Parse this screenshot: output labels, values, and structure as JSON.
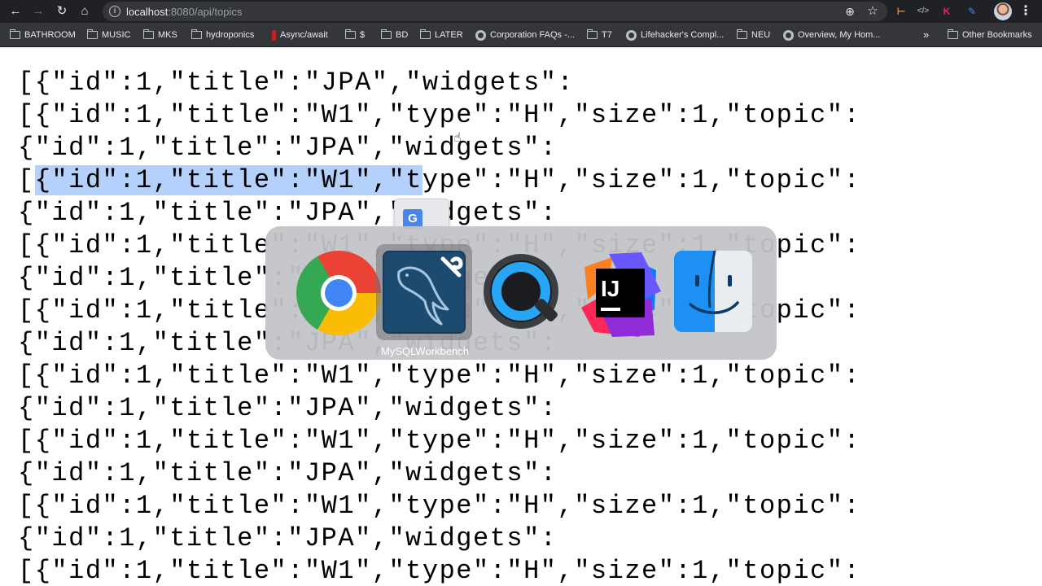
{
  "browser": {
    "url_host": "localhost",
    "url_rest": ":8080/api/topics"
  },
  "bookmarks": [
    {
      "label": "BATHROOM",
      "icon": "folder-icon"
    },
    {
      "label": "MUSIC",
      "icon": "folder-icon"
    },
    {
      "label": "MKS",
      "icon": "folder-icon"
    },
    {
      "label": "hydroponics",
      "icon": "folder-icon"
    },
    {
      "label": "Async/await",
      "icon": "bookmark-icon"
    },
    {
      "label": "$",
      "icon": "folder-icon"
    },
    {
      "label": "BD",
      "icon": "folder-icon"
    },
    {
      "label": "LATER",
      "icon": "folder-icon"
    },
    {
      "label": "Corporation FAQs -...",
      "icon": "globe-icon"
    },
    {
      "label": "T7",
      "icon": "folder-icon"
    },
    {
      "label": "Lifehacker's Compl...",
      "icon": "globe-icon"
    },
    {
      "label": "NEU",
      "icon": "folder-icon"
    },
    {
      "label": "Overview, My Hom...",
      "icon": "globe-icon"
    },
    {
      "label": "Other Bookmarks",
      "icon": "folder-icon"
    }
  ],
  "bookmarks_overflow": "»",
  "json_lines": [
    "[{\"id\":1,\"title\":\"JPA\",\"widgets\":",
    "[{\"id\":1,\"title\":\"W1\",\"type\":\"H\",\"size\":1,\"topic\":",
    "{\"id\":1,\"title\":\"JPA\",\"widgets\":",
    "[{\"id\":1,\"title\":\"W1\",\"type\":\"H\",\"size\":1,\"topic\":",
    "{\"id\":1,\"title\":\"JPA\",\"widgets\":",
    "[{\"id\":1,\"title\":\"W1\",\"type\":\"H\",\"size\":1,\"topic\":",
    "{\"id\":1,\"title\":\"JPA\",\"widgets\":",
    "[{\"id\":1,\"title\":\"W1\",\"type\":\"H\",\"size\":1,\"topic\":",
    "{\"id\":1,\"title\":\"JPA\",\"widgets\":",
    "[{\"id\":1,\"title\":\"W1\",\"type\":\"H\",\"size\":1,\"topic\":",
    "{\"id\":1,\"title\":\"JPA\",\"widgets\":",
    "[{\"id\":1,\"title\":\"W1\",\"type\":\"H\",\"size\":1,\"topic\":",
    "{\"id\":1,\"title\":\"JPA\",\"widgets\":",
    "[{\"id\":1,\"title\":\"W1\",\"type\":\"H\",\"size\":1,\"topic\":",
    "{\"id\":1,\"title\":\"JPA\",\"widgets\":",
    "[{\"id\":1,\"title\":\"W1\",\"type\":\"H\",\"size\":1,\"topic\":"
  ],
  "selection": {
    "line": 3,
    "start": 1,
    "end": 24
  },
  "app_switcher": {
    "apps": [
      "chrome-icon",
      "mysql-workbench-icon",
      "quicktime-icon",
      "intellij-idea-icon",
      "finder-icon"
    ],
    "selected": "MySQLWorkbench"
  },
  "icons": {
    "back": "back-arrow-icon",
    "forward": "forward-arrow-icon",
    "reload": "reload-icon",
    "home": "home-icon",
    "site_info": "info-icon",
    "zoom": "zoom-icon",
    "star": "star-icon",
    "menu": "more-vert-icon",
    "translate": "google-translate-icon",
    "cursor": "hand-cursor-icon"
  },
  "extension_glyphs": {
    "ext1": "⊢",
    "ext2": "</>",
    "ext3": "K",
    "ext4": "✎"
  },
  "colors": {
    "toolbar_bg": "#202124",
    "bookmarks_bg": "#35363a",
    "selection": "#b3d1fb",
    "switcher_bg": "#c1c3c7"
  }
}
